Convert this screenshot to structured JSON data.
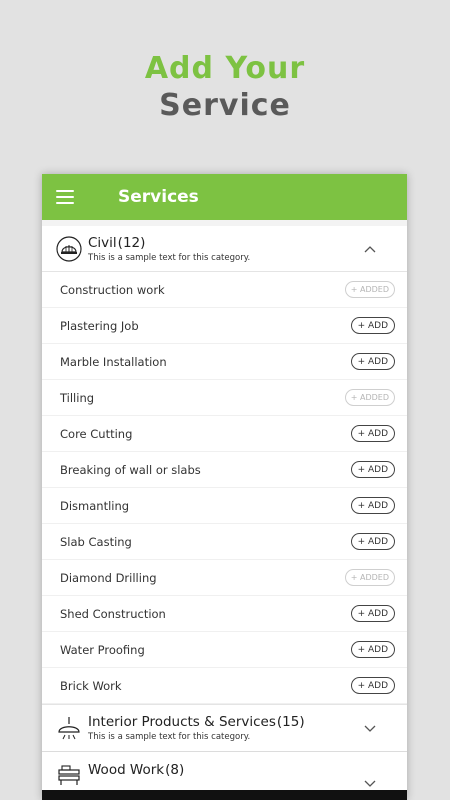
{
  "hero": {
    "line1": "Add Your",
    "line2": "Service"
  },
  "appbar": {
    "title": "Services"
  },
  "categories": [
    {
      "title": "Civil",
      "count": "(12)",
      "subtitle": "This is a sample text for this category.",
      "icon": "helmet-icon",
      "expanded": true
    },
    {
      "title": "Interior Products & Services",
      "count": "(15)",
      "subtitle": "This is a sample text for this category.",
      "icon": "ceiling-lamp-icon",
      "expanded": false
    },
    {
      "title": "Wood Work",
      "count": "(8)",
      "subtitle": "",
      "icon": "sawmill-icon",
      "expanded": false
    }
  ],
  "services": [
    {
      "name": "Construction work",
      "action": "+ ADDED",
      "added": true
    },
    {
      "name": "Plastering Job",
      "action": "+ ADD",
      "added": false
    },
    {
      "name": "Marble Installation",
      "action": "+ ADD",
      "added": false
    },
    {
      "name": "Tilling",
      "action": "+ ADDED",
      "added": true
    },
    {
      "name": "Core Cutting",
      "action": "+ ADD",
      "added": false
    },
    {
      "name": "Breaking of wall or slabs",
      "action": "+ ADD",
      "added": false
    },
    {
      "name": "Dismantling",
      "action": "+ ADD",
      "added": false
    },
    {
      "name": "Slab Casting",
      "action": "+ ADD",
      "added": false
    },
    {
      "name": "Diamond Drilling",
      "action": "+ ADDED",
      "added": true
    },
    {
      "name": "Shed Construction",
      "action": "+ ADD",
      "added": false
    },
    {
      "name": "Water Proofing",
      "action": "+ ADD",
      "added": false
    },
    {
      "name": "Brick Work",
      "action": "+ ADD",
      "added": false
    }
  ],
  "colors": {
    "accent": "#7dc242",
    "heading_gray": "#5a5a5a",
    "background": "#e2e2e2"
  }
}
